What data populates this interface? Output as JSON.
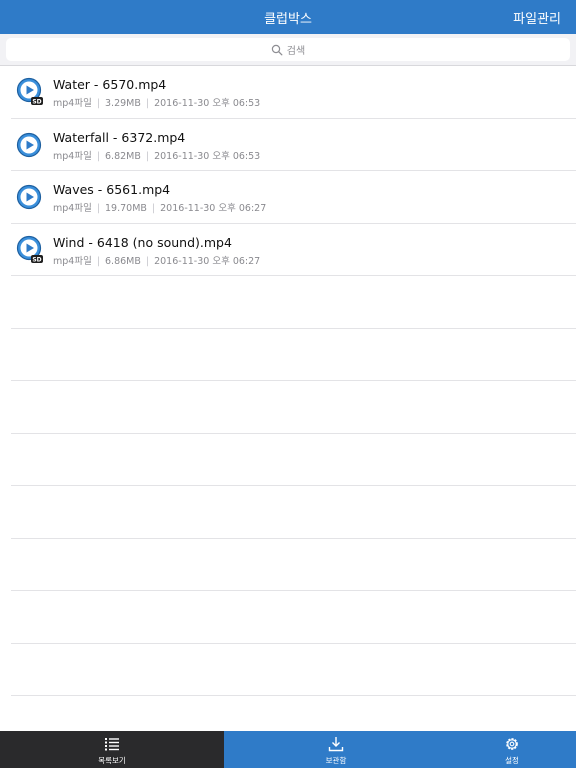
{
  "header": {
    "title": "클럽박스",
    "right_button": "파일관리"
  },
  "search": {
    "placeholder": "검색"
  },
  "files": [
    {
      "name": "Water - 6570.mp4",
      "type": "mp4파일",
      "size": "3.29MB",
      "date": "2016-11-30 오후 06:53",
      "icon": "play-video-sd-icon"
    },
    {
      "name": "Waterfall - 6372.mp4",
      "type": "mp4파일",
      "size": "6.82MB",
      "date": "2016-11-30 오후 06:53",
      "icon": "play-video-icon"
    },
    {
      "name": "Waves - 6561.mp4",
      "type": "mp4파일",
      "size": "19.70MB",
      "date": "2016-11-30 오후 06:27",
      "icon": "play-video-icon"
    },
    {
      "name": "Wind - 6418 (no sound).mp4",
      "type": "mp4파일",
      "size": "6.86MB",
      "date": "2016-11-30 오후 06:27",
      "icon": "play-video-sd-icon"
    }
  ],
  "tabbar": {
    "tabs": [
      {
        "label": "목록보기",
        "icon": "list-icon",
        "active": true
      },
      {
        "label": "보관함",
        "icon": "download-tray-icon",
        "active": false
      },
      {
        "label": "설정",
        "icon": "gear-icon",
        "active": false
      }
    ]
  },
  "colors": {
    "accent": "#2f7bc8",
    "active_tab": "#2a2a2c",
    "meta_text": "#8a8a8f"
  }
}
